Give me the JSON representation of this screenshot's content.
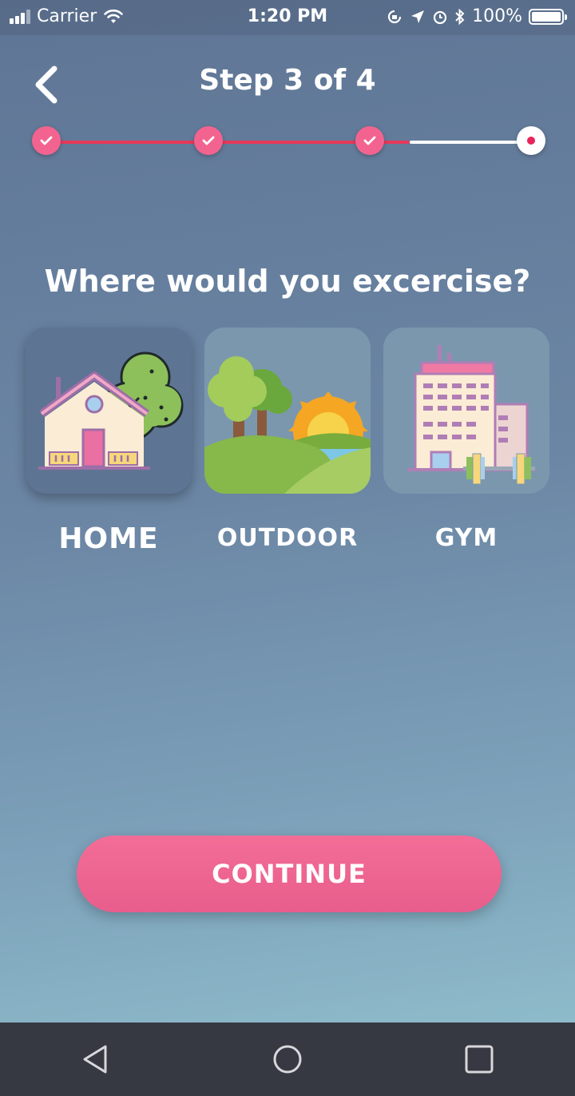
{
  "status_bar": {
    "carrier": "Carrier",
    "time": "1:20 PM",
    "battery": "100%"
  },
  "header": {
    "title": "Step 3 of 4"
  },
  "stepper": {
    "current_step": 3,
    "total_steps": 4,
    "completed_steps": 3
  },
  "question": "Where would you excercise?",
  "options": [
    {
      "label": "HOME",
      "selected": true
    },
    {
      "label": "OUTDOOR",
      "selected": false
    },
    {
      "label": "GYM",
      "selected": false
    }
  ],
  "continue_label": "CONTINUE",
  "colors": {
    "accent": "#f2648f",
    "progress": "#e8385a",
    "nav_bar": "#363942"
  },
  "icons": {
    "back": "chevron-left-icon",
    "nav": [
      "back-triangle-icon",
      "home-circle-icon",
      "recents-square-icon"
    ]
  }
}
